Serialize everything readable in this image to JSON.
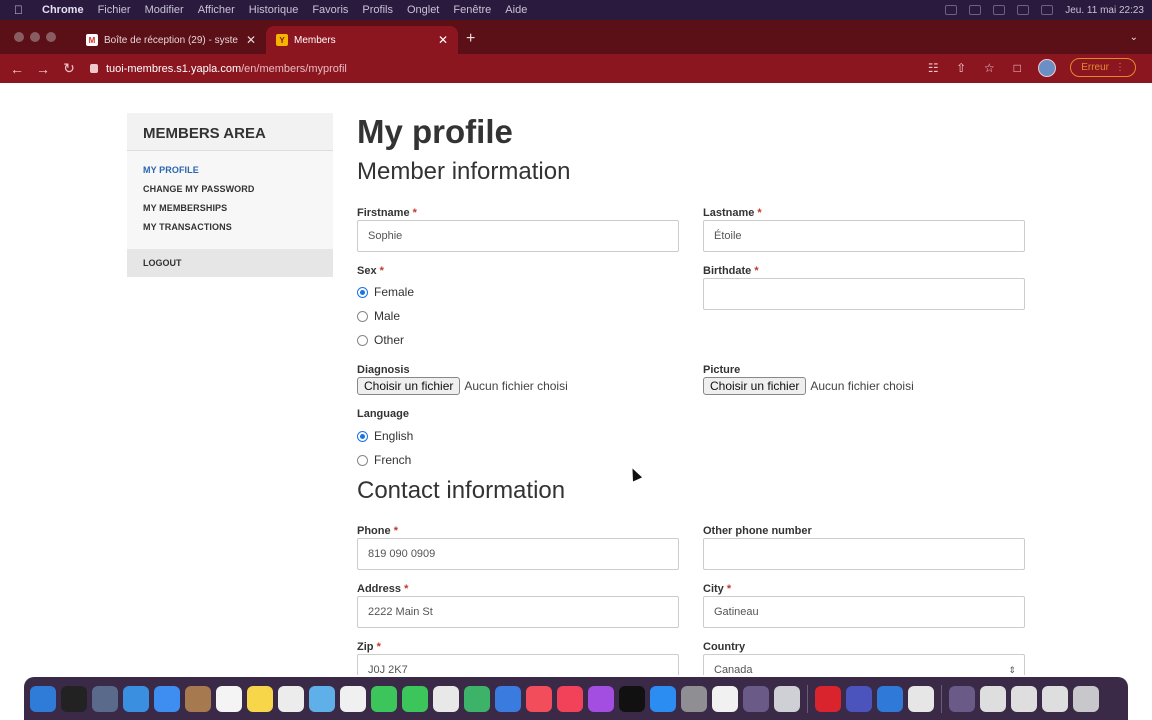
{
  "menubar": {
    "app": "Chrome",
    "items": [
      "Fichier",
      "Modifier",
      "Afficher",
      "Historique",
      "Favoris",
      "Profils",
      "Onglet",
      "Fenêtre",
      "Aide"
    ],
    "clock": "Jeu. 11 mai  22:23"
  },
  "tabs": [
    {
      "title": "Boîte de réception (29) - syste",
      "favicon": "gmail-icon",
      "active": false
    },
    {
      "title": "Members",
      "favicon": "yapla-icon",
      "active": true
    }
  ],
  "toolbar": {
    "url_host": "tuoi-membres.s1.yapla.com",
    "url_path": "/en/members/myprofil",
    "error_label": "Erreur"
  },
  "sidebar": {
    "title": "MEMBERS AREA",
    "items": [
      "MY PROFILE",
      "CHANGE MY PASSWORD",
      "MY MEMBERSHIPS",
      "MY TRANSACTIONS"
    ],
    "logout": "LOGOUT"
  },
  "main": {
    "title": "My profile",
    "section_member": "Member information",
    "section_contact": "Contact information",
    "required_mark": "*",
    "firstname": {
      "label": "Firstname",
      "value": "Sophie"
    },
    "lastname": {
      "label": "Lastname",
      "value": "Étoile"
    },
    "sex": {
      "label": "Sex",
      "options": [
        "Female",
        "Male",
        "Other"
      ],
      "selected": "Female"
    },
    "birthdate": {
      "label": "Birthdate",
      "value": ""
    },
    "diagnosis": {
      "label": "Diagnosis",
      "button": "Choisir un fichier",
      "status": "Aucun fichier choisi"
    },
    "picture": {
      "label": "Picture",
      "button": "Choisir un fichier",
      "status": "Aucun fichier choisi"
    },
    "language": {
      "label": "Language",
      "options": [
        "English",
        "French"
      ],
      "selected": "English"
    },
    "phone": {
      "label": "Phone",
      "value": "819 090 0909"
    },
    "other_phone": {
      "label": "Other phone number",
      "value": ""
    },
    "address": {
      "label": "Address",
      "value": "2222 Main St"
    },
    "city": {
      "label": "City",
      "value": "Gatineau"
    },
    "zip": {
      "label": "Zip",
      "value": "J0J 2K7"
    },
    "country": {
      "label": "Country",
      "value": "Canada"
    }
  },
  "colors": {
    "browser_frame": "#8c1620",
    "active_link": "#2a66b0",
    "required": "#c0392b"
  }
}
